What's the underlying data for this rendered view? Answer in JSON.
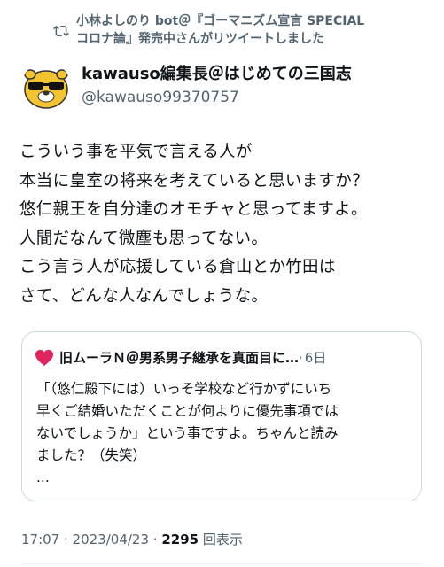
{
  "retweet": {
    "line1": "小林よしのり bot＠『ゴーマニズム宣言 SPECIAL",
    "line2": "コロナ論』発売中さんがリツイートしました"
  },
  "author": {
    "display_name": "kawauso編集長＠はじめての三国志",
    "handle": "@kawauso99370757"
  },
  "tweet": {
    "lines": [
      "こういう事を平気で言える人が",
      "本当に皇室の将来を考えていると思いますか？",
      "悠仁親王を自分達のオモチャと思ってますよ。",
      "人間だなんて微塵も思ってない。",
      "こう言う人が応援している倉山とか竹田は",
      "さて、どんな人なんでしょうな。"
    ]
  },
  "quote": {
    "name": "旧ムーラＮ＠男系男子継承を真面目に…",
    "dot": "·",
    "time": "6日",
    "lines": [
      "「（悠仁殿下には）いっそ学校など行かずにいち",
      "早くご結婚いただくことが何よりに優先事項では",
      "ないでしょうか」という事ですよ。ちゃんと読み",
      "ました？（失笑）",
      "..."
    ]
  },
  "meta": {
    "time": "17:07",
    "sep": " · ",
    "date": "2023/04/23",
    "sep2": " · ",
    "views_count": "2295",
    "views_label": " 回表示"
  },
  "colors": {
    "secondary": "#536471",
    "heart": "#e0245e",
    "border": "#cfd9de"
  }
}
